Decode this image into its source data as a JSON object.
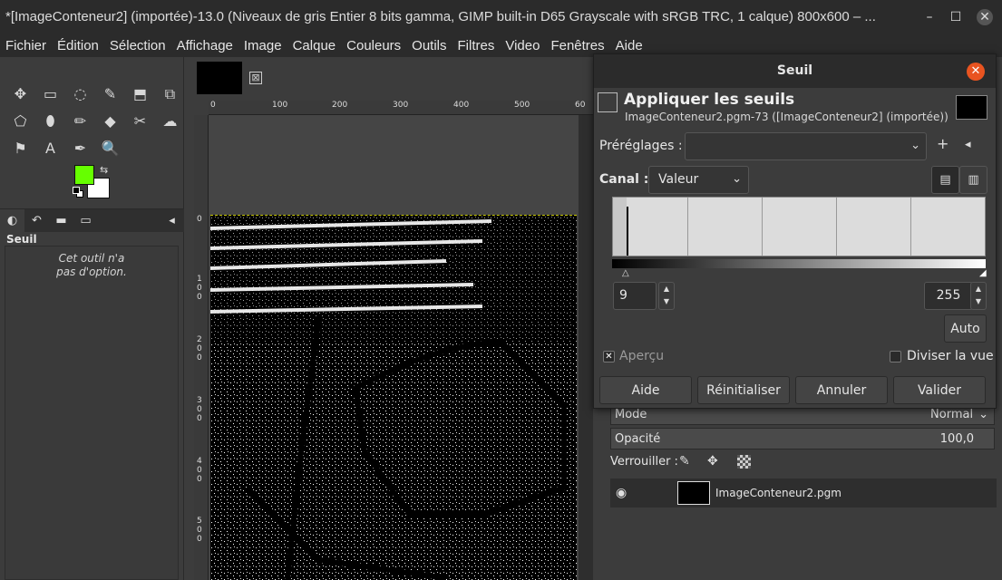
{
  "window": {
    "title": "*[ImageConteneur2] (importée)-13.0 (Niveaux de gris Entier 8 bits gamma, GIMP built-in D65 Grayscale with sRGB TRC, 1 calque) 800x600 – ...",
    "minimize": "–",
    "maximize": "☐",
    "close": "✕"
  },
  "menu": [
    "Fichier",
    "Édition",
    "Sélection",
    "Affichage",
    "Image",
    "Calque",
    "Couleurs",
    "Outils",
    "Filtres",
    "Video",
    "Fenêtres",
    "Aide"
  ],
  "toolbox": {
    "tools_row1": [
      "✥",
      "▭",
      "◌",
      "✎",
      "⬒",
      "⧉"
    ],
    "tools_row2": [
      "⬠",
      "⬮",
      "✏",
      "◆",
      "✂",
      "☁"
    ],
    "tools_row3": [
      "⚑",
      "A",
      "✒",
      "🔍"
    ],
    "fg_color": "#66ff00",
    "bg_color": "#ffffff",
    "options_title": "Seuil",
    "options_message_line1": "Cet outil n'a",
    "options_message_line2": "pas d'option."
  },
  "image": {
    "close_glyph": "⊠",
    "ruler_h": [
      "0",
      "100",
      "200",
      "300",
      "400",
      "500",
      "60"
    ],
    "ruler_v": [
      "0",
      "1 0 0",
      "2 0 0",
      "3 0 0",
      "4 0 0",
      "5 0 0"
    ]
  },
  "dialog": {
    "title": "Seuil",
    "close": "✕",
    "heading": "Appliquer les seuils",
    "subtitle": "ImageConteneur2.pgm-73 ([ImageConteneur2] (importée))",
    "presets_label": "Préréglages :",
    "presets_value": "",
    "add_glyph": "+",
    "menu_glyph": "◂",
    "channel_label": "Canal :",
    "channel_value": "Valeur",
    "low_value": "9",
    "high_value": "255",
    "auto": "Auto",
    "preview_label": "Aperçu",
    "preview_checked": true,
    "split_label": "Diviser la vue",
    "split_checked": false,
    "buttons": [
      "Aide",
      "Réinitialiser",
      "Annuler",
      "Valider"
    ]
  },
  "layers": {
    "mode_label": "Mode",
    "mode_value": "Normal",
    "opacity_label": "Opacité",
    "opacity_value": "100,0",
    "lock_label": "Verrouiller :",
    "layer_name": "ImageConteneur2.pgm"
  }
}
